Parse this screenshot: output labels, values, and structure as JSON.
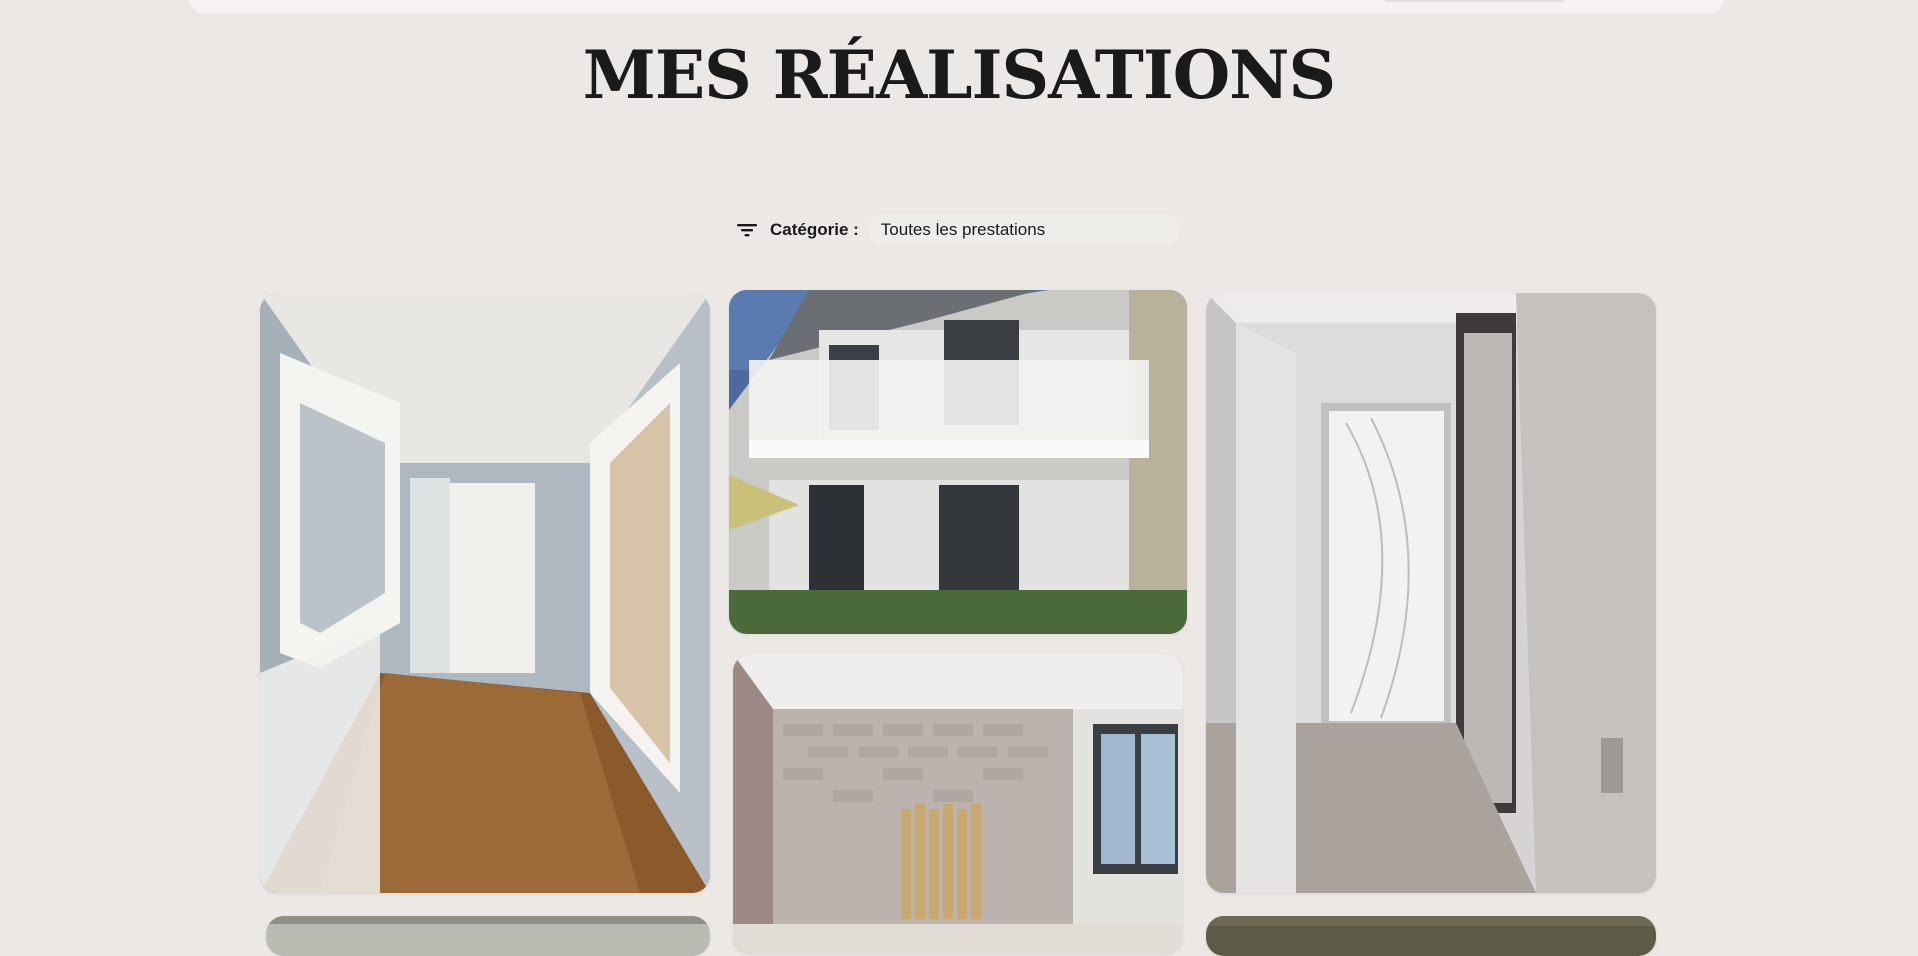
{
  "page": {
    "title": "MES RÉALISATIONS"
  },
  "filter": {
    "icon": "filter-icon",
    "label": "Catégorie :",
    "selected": "Toutes les prestations"
  },
  "gallery": {
    "items": [
      {
        "subject": "hallway with mirror and wooden floor"
      },
      {
        "subject": "house facade with white balcony"
      },
      {
        "subject": "hallway with white door and sliding wardrobe"
      },
      {
        "subject": "room with brick-effect wallpaper"
      }
    ]
  }
}
